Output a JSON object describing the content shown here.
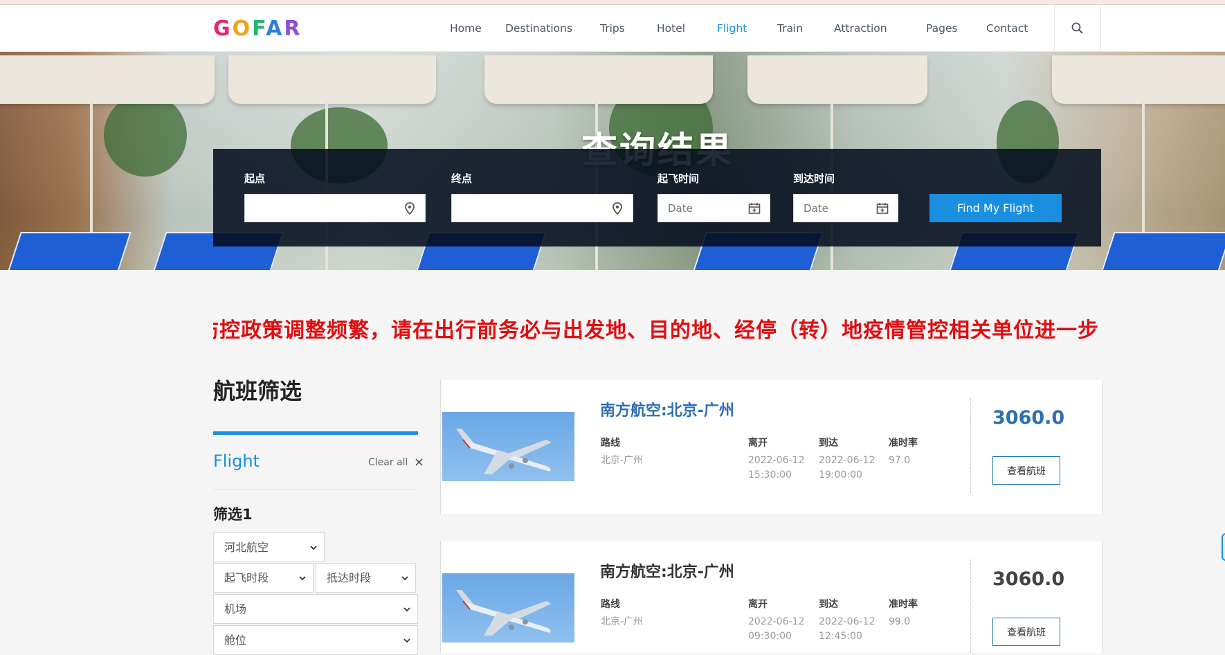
{
  "brand": {
    "logo_text": "GOFAR"
  },
  "nav": {
    "items": [
      {
        "label": "Home"
      },
      {
        "label": "Destinations"
      },
      {
        "label": "Trips"
      },
      {
        "label": "Hotel"
      },
      {
        "label": "Flight",
        "active": true
      },
      {
        "label": "Train"
      },
      {
        "label": "Attraction"
      },
      {
        "label": "Pages"
      },
      {
        "label": "Contact"
      }
    ],
    "search_icon": "search-icon"
  },
  "hero": {
    "title": "查询结果"
  },
  "search": {
    "origin_label": "起点",
    "origin_value": "",
    "destination_label": "终点",
    "destination_value": "",
    "depart_label": "起飞时间",
    "depart_placeholder": "Date",
    "arrive_label": "到达时间",
    "arrive_placeholder": "Date",
    "submit_label": "Find My Flight"
  },
  "notice": "防控政策调整频繁，请在出行前务必与出发地、目的地、经停（转）地疫情管控相关单位进一步",
  "filters": {
    "title": "航班筛选",
    "section_label": "Flight",
    "clear_label": "Clear all",
    "group_label": "筛选1",
    "airline": "河北航空",
    "depart_period": "起飞时段",
    "arrive_period": "抵达时段",
    "airport": "机场",
    "cabin": "舱位"
  },
  "results": {
    "col_route": "路线",
    "col_depart": "离开",
    "col_arrive": "到达",
    "col_ontime": "准时率",
    "view_label": "查看航班",
    "flights": [
      {
        "title": "南方航空:北京-广州",
        "route": "北京-广州",
        "depart_date": "2022-06-12",
        "depart_time": "15:30:00",
        "arrive_date": "2022-06-12",
        "arrive_time": "19:00:00",
        "ontime": "97.0",
        "price": "3060.0"
      },
      {
        "title": "南方航空:北京-广州",
        "route": "北京-广州",
        "depart_date": "2022-06-12",
        "depart_time": "09:30:00",
        "arrive_date": "2022-06-12",
        "arrive_time": "12:45:00",
        "ontime": "99.0",
        "price": "3060.0"
      }
    ]
  },
  "colors": {
    "accent": "#1a8fe0",
    "notice": "#e00d10",
    "title_blue": "#2d6fb1"
  }
}
